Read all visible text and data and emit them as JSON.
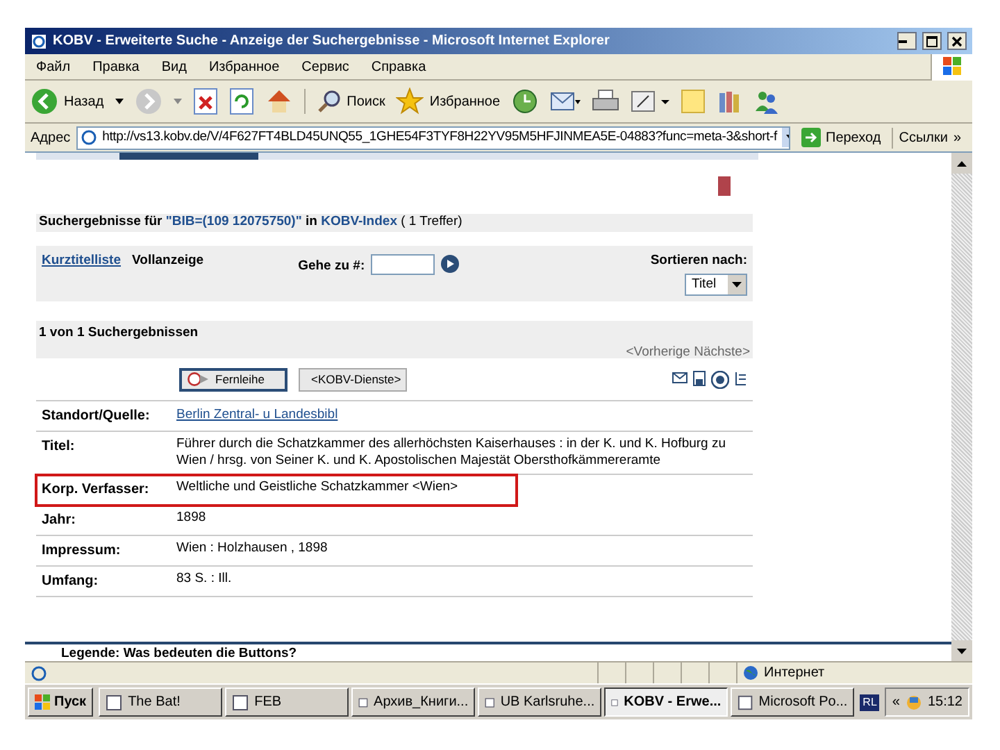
{
  "window": {
    "title": "KOBV - Erweiterte Suche - Anzeige der Suchergebnisse - Microsoft Internet Explorer"
  },
  "menu": [
    "Файл",
    "Правка",
    "Вид",
    "Избранное",
    "Сервис",
    "Справка"
  ],
  "toolbar": {
    "back": "Назад",
    "search": "Поиск",
    "favorites": "Избранное"
  },
  "address": {
    "label": "Адрес",
    "url": "http://vs13.kobv.de/V/4F627FT4BLD45UNQ55_1GHE54F3TYF8H22YV95M5HFJINMEA5E-04883?func=meta-3&short-f",
    "go": "Переход",
    "links": "Ссылки",
    "more": "»"
  },
  "results": {
    "prefix": "Suchergebnisse für",
    "query": "\"BIB=(109 12075750)\"",
    "connector": "in",
    "index": "KOBV-Index",
    "count": "( 1 Treffer)"
  },
  "view_tabs": [
    {
      "label": "Kurztitelliste",
      "selected": false
    },
    {
      "label": "Vollanzeige",
      "selected": true
    }
  ],
  "goto": {
    "label": "Gehe zu #:"
  },
  "sort": {
    "label": "Sortieren nach:",
    "value": "Titel"
  },
  "position": "1 von 1 Suchergebnissen",
  "pager": "<Vorherige Nächste>",
  "action_buttons": [
    "Fernleihe",
    "<KOBV-Dienste>"
  ],
  "record": [
    {
      "label": "Standort/Quelle:",
      "value": "Berlin Zentral- u Landesbibl",
      "kind": "link",
      "highlighted": false
    },
    {
      "label": "Titel:",
      "value": "Führer durch die Schatzkammer des allerhöchsten Kaiserhauses : in der K. und K. Hofburg zu Wien / hrsg. von Seiner K. und K. Apostolischen Majestät Obersthofkämmereramte",
      "kind": "text",
      "highlighted": false
    },
    {
      "label": "Korp. Verfasser:",
      "value": "Weltliche und Geistliche Schatzkammer <Wien>",
      "kind": "text",
      "highlighted": true
    },
    {
      "label": "Jahr:",
      "value": "1898",
      "kind": "text",
      "highlighted": false
    },
    {
      "label": "Impressum:",
      "value": "Wien : Holzhausen , 1898",
      "kind": "text",
      "highlighted": false
    },
    {
      "label": "Umfang:",
      "value": "83 S. : Ill.",
      "kind": "text",
      "highlighted": false
    }
  ],
  "legend": "Legende: Was bedeuten die Buttons?",
  "status_bar": {
    "zone": "Интернет"
  },
  "taskbar": {
    "start": "Пуск",
    "tasks": [
      {
        "label": "The Bat!",
        "selected": false
      },
      {
        "label": "FEB",
        "selected": false
      },
      {
        "label": "Архив_Книги...",
        "selected": false
      },
      {
        "label": "UB Karlsruhe...",
        "selected": false
      },
      {
        "label": "KOBV - Erwe...",
        "selected": true
      },
      {
        "label": "Microsoft Po...",
        "selected": false
      }
    ],
    "language": "RL",
    "chevron": "«",
    "clock": "15:12"
  }
}
